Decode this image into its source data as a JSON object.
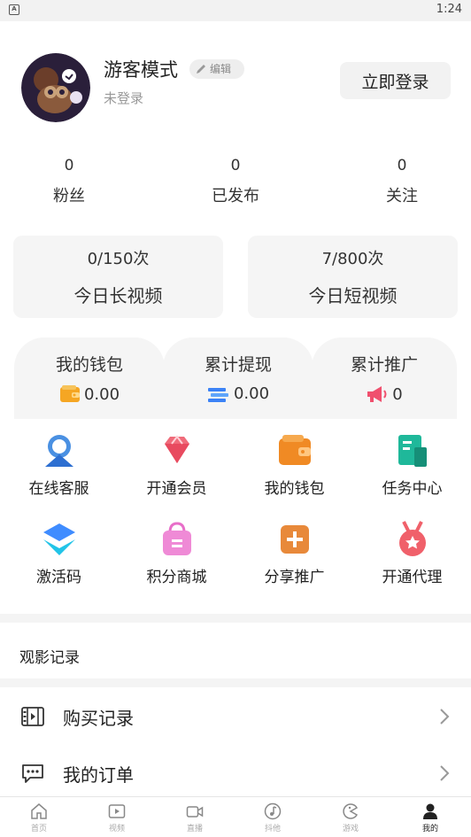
{
  "status_bar": {
    "time": "1:24",
    "app_badge": "A"
  },
  "profile": {
    "username": "游客模式",
    "edit_label": "编辑",
    "login_status": "未登录",
    "login_button": "立即登录"
  },
  "stats": [
    {
      "value": "0",
      "label": "粉丝"
    },
    {
      "value": "0",
      "label": "已发布"
    },
    {
      "value": "0",
      "label": "关注"
    }
  ],
  "quotas": [
    {
      "count": "0/150次",
      "label": "今日长视频"
    },
    {
      "count": "7/800次",
      "label": "今日短视频"
    }
  ],
  "wallet": [
    {
      "label": "我的钱包",
      "value": "0.00",
      "icon": "wallet-icon"
    },
    {
      "label": "累计提现",
      "value": "0.00",
      "icon": "withdraw-icon"
    },
    {
      "label": "累计推广",
      "value": "0",
      "icon": "megaphone-icon"
    }
  ],
  "features": [
    {
      "label": "在线客服",
      "icon": "customer-service-icon"
    },
    {
      "label": "开通会员",
      "icon": "diamond-icon"
    },
    {
      "label": "我的钱包",
      "icon": "wallet-icon"
    },
    {
      "label": "任务中心",
      "icon": "task-icon"
    },
    {
      "label": "激活码",
      "icon": "layers-icon"
    },
    {
      "label": "积分商城",
      "icon": "shopping-bag-icon"
    },
    {
      "label": "分享推广",
      "icon": "share-icon"
    },
    {
      "label": "开通代理",
      "icon": "medal-icon"
    }
  ],
  "history": {
    "label": "观影记录"
  },
  "menu": [
    {
      "label": "购买记录",
      "icon": "film-icon"
    },
    {
      "label": "我的订单",
      "icon": "chat-icon"
    }
  ],
  "tabbar": [
    {
      "label": "首页",
      "icon": "home-icon"
    },
    {
      "label": "视频",
      "icon": "video-icon"
    },
    {
      "label": "直播",
      "icon": "camera-icon"
    },
    {
      "label": "抖他",
      "icon": "music-icon"
    },
    {
      "label": "游戏",
      "icon": "game-icon"
    },
    {
      "label": "我的",
      "icon": "user-icon"
    }
  ],
  "colors": {
    "wallet_orange": "#f5a623",
    "withdraw_blue": "#3b82f6",
    "promo_red": "#f0506e",
    "card_bg": "#f5f5f5"
  }
}
